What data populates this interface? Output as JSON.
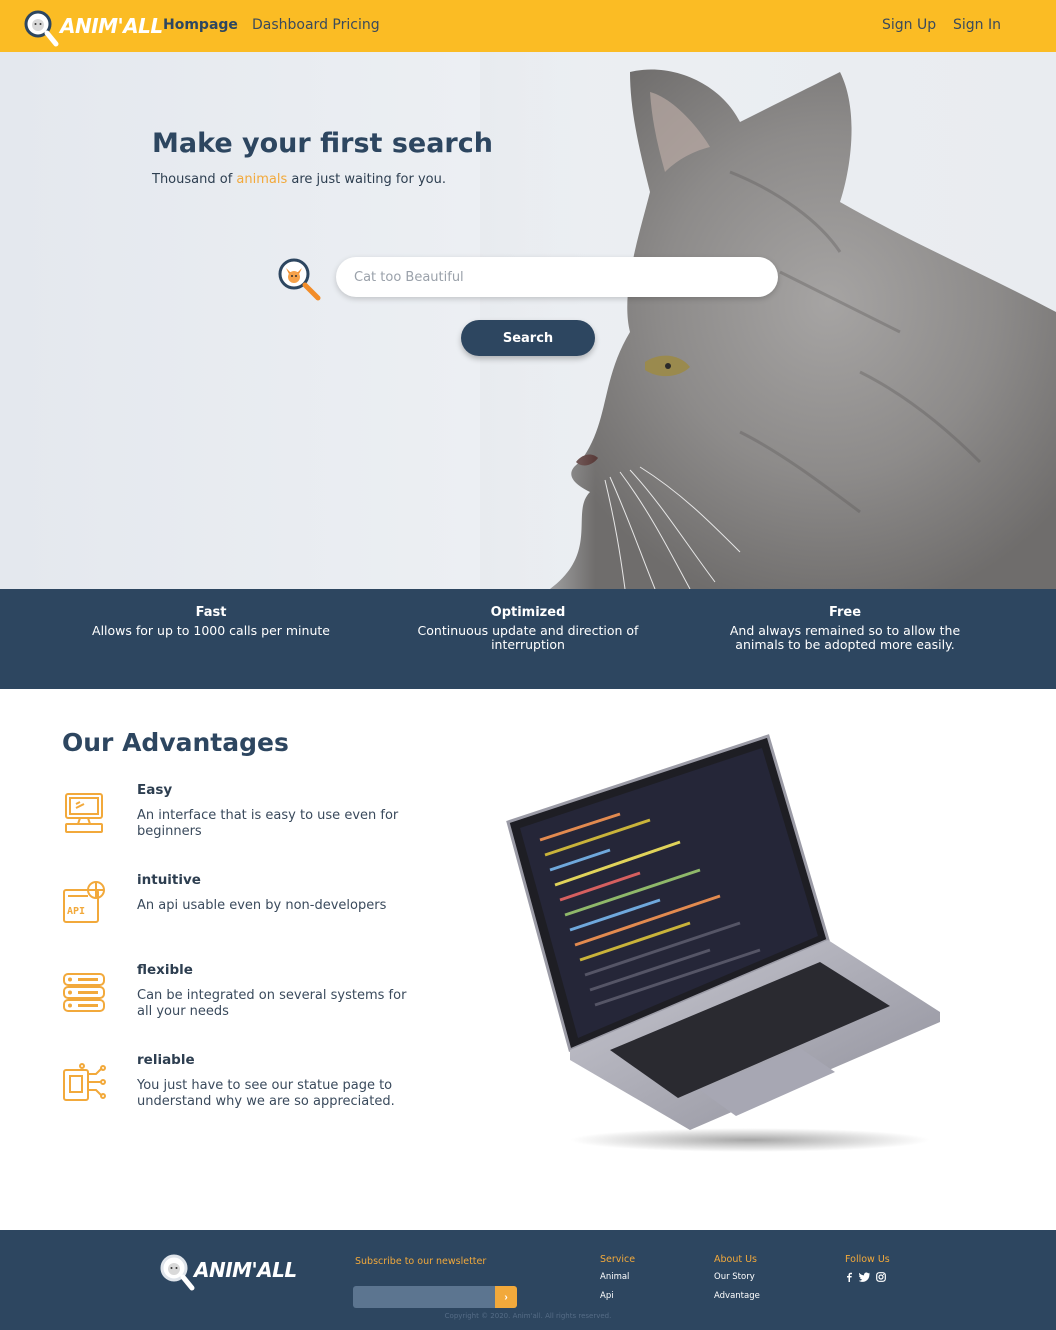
{
  "nav": {
    "logo": "ANIM'ALL",
    "links": [
      "Hompage",
      "Dashboard Pricing"
    ],
    "auth": [
      "Sign Up",
      "Sign In"
    ]
  },
  "hero": {
    "title": "Make your first search",
    "subtitle_before": "Thousand of ",
    "subtitle_accent": "animals",
    "subtitle_after": " are just waiting for you.",
    "search_placeholder": "Cat too Beautiful",
    "search_button": "Search"
  },
  "features": [
    {
      "title": "Fast",
      "desc": "Allows for up to 1000 calls per minute"
    },
    {
      "title": "Optimized",
      "desc": "Continuous update and direction of interruption"
    },
    {
      "title": "Free",
      "desc": "And always remained so to allow the animals to be adopted more easily."
    }
  ],
  "advantages": {
    "title": "Our Advantages",
    "items": [
      {
        "name": "Easy",
        "desc": "An interface that is easy to use even for beginners",
        "icon": "computer-icon"
      },
      {
        "name": "intuitive",
        "desc": "An api usable even by non-developers",
        "icon": "api-icon"
      },
      {
        "name": "flexible",
        "desc": "Can be integrated on several systems for all your needs",
        "icon": "server-icon"
      },
      {
        "name": "reliable",
        "desc": "You just have to see our statue page to understand why we are so appreciated.",
        "icon": "chip-icon"
      }
    ]
  },
  "footer": {
    "logo": "ANIM'ALL",
    "subscribe": "Subscribe to our newsletter",
    "go": "›",
    "service": {
      "head": "Service",
      "links": [
        "Animal",
        "Api"
      ]
    },
    "about": {
      "head": "About Us",
      "links": [
        "Our Story",
        "Advantage"
      ]
    },
    "follow": {
      "head": "Follow Us",
      "icons": [
        "facebook-icon",
        "twitter-icon",
        "instagram-icon"
      ]
    },
    "copyright": "Copyright © 2020. Anim'all. All rights reserved."
  },
  "colors": {
    "brand_yellow": "#fbbc24",
    "navy": "#2d4660",
    "accent_orange": "#f2a93b"
  }
}
